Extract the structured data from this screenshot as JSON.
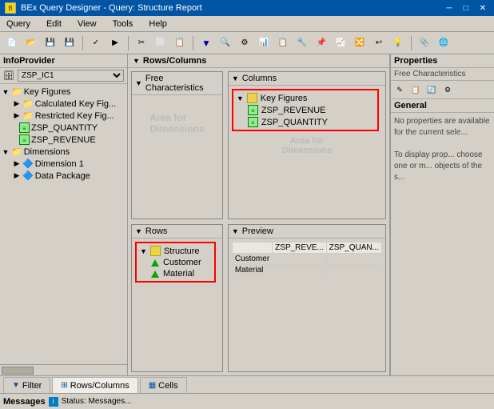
{
  "titleBar": {
    "icon": "BEx",
    "text": "BEx Query Designer - Query: Structure Report"
  },
  "menuBar": {
    "items": [
      "Query",
      "Edit",
      "View",
      "Tools",
      "Help"
    ]
  },
  "infoProvider": {
    "header": "InfoProvider",
    "selector": "ZSP_IC1",
    "tree": [
      {
        "id": "key-figures",
        "label": "Key Figures",
        "indent": 0,
        "type": "folder",
        "expanded": true
      },
      {
        "id": "calc-key-fig",
        "label": "Calculated Key Fig...",
        "indent": 1,
        "type": "folder",
        "expanded": false
      },
      {
        "id": "restricted-key-fig",
        "label": "Restricted Key Fig...",
        "indent": 1,
        "type": "folder",
        "expanded": false
      },
      {
        "id": "zsp-quantity",
        "label": "ZSP_QUANTITY",
        "indent": 1,
        "type": "kf"
      },
      {
        "id": "zsp-revenue",
        "label": "ZSP_REVENUE",
        "indent": 1,
        "type": "kf"
      },
      {
        "id": "dimensions",
        "label": "Dimensions",
        "indent": 0,
        "type": "folder",
        "expanded": true
      },
      {
        "id": "dimension1",
        "label": "Dimension 1",
        "indent": 1,
        "type": "dim",
        "expanded": false
      },
      {
        "id": "data-package",
        "label": "Data Package",
        "indent": 1,
        "type": "dim",
        "expanded": false
      }
    ]
  },
  "rowsColumns": {
    "header": "Rows/Columns",
    "freeChar": {
      "header": "Free Characteristics",
      "areaText": "Area for\nDimensions"
    },
    "columns": {
      "header": "Columns",
      "items": [
        {
          "label": "Key Figures",
          "type": "structure"
        },
        {
          "label": "ZSP_REVENUE",
          "type": "kf"
        },
        {
          "label": "ZSP_QUANTITY",
          "type": "kf"
        }
      ],
      "areaText": "Area for\nDimensions"
    },
    "rows": {
      "header": "Rows",
      "structure": "Structure",
      "items": [
        {
          "label": "Customer",
          "type": "char"
        },
        {
          "label": "Material",
          "type": "char"
        }
      ]
    },
    "preview": {
      "header": "Preview",
      "columns": [
        "ZSP_REVE...",
        "ZSP_QUAN..."
      ],
      "rows": [
        {
          "label": "Customer",
          "values": [
            "",
            ""
          ]
        },
        {
          "label": "Material",
          "values": [
            "",
            ""
          ]
        }
      ]
    }
  },
  "properties": {
    "header": "Properties",
    "subheader": "Free Characteristics",
    "tabs": [
      "General"
    ],
    "activeTab": "General",
    "content": "No properties are\navailable for\nthe current sele...",
    "hint": "To display prop...\nchoose one or m...\nobjects of the s..."
  },
  "bottomTabs": [
    {
      "label": "Filter",
      "icon": "funnel"
    },
    {
      "label": "Rows/Columns",
      "icon": "grid"
    },
    {
      "label": "Cells",
      "icon": "cell"
    }
  ],
  "activeBottomTab": "Rows/Columns",
  "messages": {
    "header": "Messages",
    "statusIcon": "i",
    "text": "Status: Messages..."
  }
}
